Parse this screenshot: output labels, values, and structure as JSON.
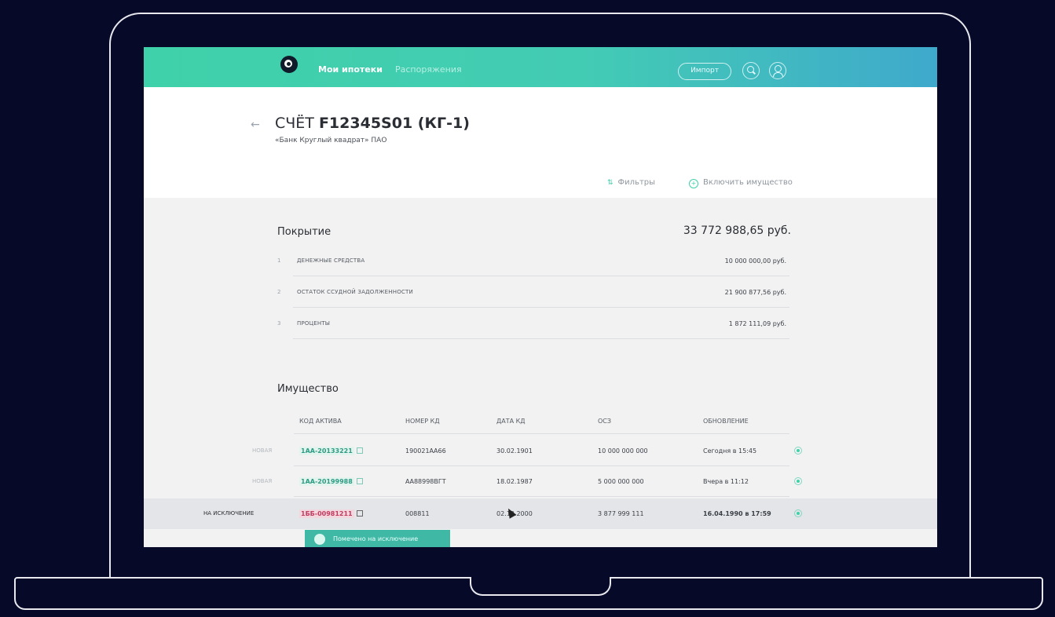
{
  "nav": {
    "active": "Мои ипотеки",
    "inactive": "Распоряжения",
    "import_label": "Импорт"
  },
  "header": {
    "back_icon": "arrow-left-icon",
    "title_prefix": "СЧЁТ",
    "account_number": "F12345S01 (КГ-1)",
    "subtitle": "«Банк Круглый квадрат» ПАО",
    "filters_label": "Фильтры",
    "include_label": "Включить имущество"
  },
  "coverage": {
    "title": "Покрытие",
    "total": "33 772 988,65 руб.",
    "rows": [
      {
        "idx": "1",
        "label": "ДЕНЕЖНЫЕ СРЕДСТВА",
        "amount": "10 000 000,00 руб."
      },
      {
        "idx": "2",
        "label": "ОСТАТОК ССУДНОЙ ЗАДОЛЖЕННОСТИ",
        "amount": "21 900 877,56 руб."
      },
      {
        "idx": "3",
        "label": "ПРОЦЕНТЫ",
        "amount": "1 872 111,09 руб."
      }
    ]
  },
  "property": {
    "title": "Имущество",
    "columns": [
      "КОД АКТИВА",
      "НОМЕР КД",
      "ДАТА КД",
      "ОСЗ",
      "ОБНОВЛЕНИЕ"
    ],
    "rows": [
      {
        "status": "НОВАЯ",
        "code": "1АА-20133221",
        "kd_num": "190021АА66",
        "kd_date": "30.02.1901",
        "osz": "10 000 000 000",
        "updated": "Сегодня в 15:45"
      },
      {
        "status": "НОВАЯ",
        "code": "1АА-20199988",
        "kd_num": "АА88998ВГТ",
        "kd_date": "18.02.1987",
        "osz": "5 000 000 000",
        "updated": "Вчера в 11:12"
      },
      {
        "status": "НА ИСКЛЮЧЕНИЕ",
        "code": "1ББ-00981211",
        "kd_num": "008811",
        "kd_date": "02.12.2000",
        "osz": "3 877 999 111",
        "updated": "16.04.1990 в 17:59"
      }
    ],
    "tooltip": "Помечено на исключение"
  },
  "colors": {
    "accent": "#3fd1a9",
    "topbar_end": "#3fa9cc",
    "exclusion": "#c23b5f"
  }
}
